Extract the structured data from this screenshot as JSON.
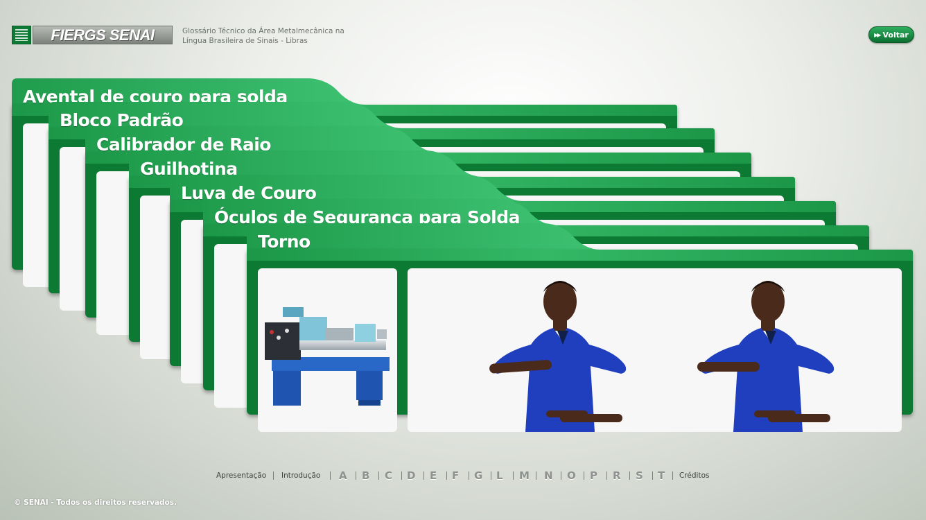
{
  "header": {
    "logo_text": "FIERGS SENAI",
    "site_title_line1": "Glossário Técnico da Área Metalmecânica na",
    "site_title_line2": "Língua Brasileira de Sinais - Libras",
    "back_button": "Voltar"
  },
  "cards": [
    {
      "title": "Avental de couro para solda"
    },
    {
      "title": "Bloco Padrão"
    },
    {
      "title": "Calibrador de Raio"
    },
    {
      "title": "Guilhotina"
    },
    {
      "title": "Luva de Couro"
    },
    {
      "title": "Óculos de Segurança para Solda"
    },
    {
      "title": "Torno"
    }
  ],
  "nav": {
    "apresentacao": "Apresentação",
    "introducao": "Introdução",
    "letters": [
      "A",
      "B",
      "C",
      "D",
      "E",
      "F",
      "G",
      "L",
      "M",
      "N",
      "O",
      "P",
      "R",
      "S",
      "T"
    ],
    "creditos": "Créditos"
  },
  "footer": {
    "copyright": "© SENAI - Todos os direitos reservados."
  },
  "colors": {
    "card_green": "#0d7a34",
    "accent_green": "#34b866"
  }
}
